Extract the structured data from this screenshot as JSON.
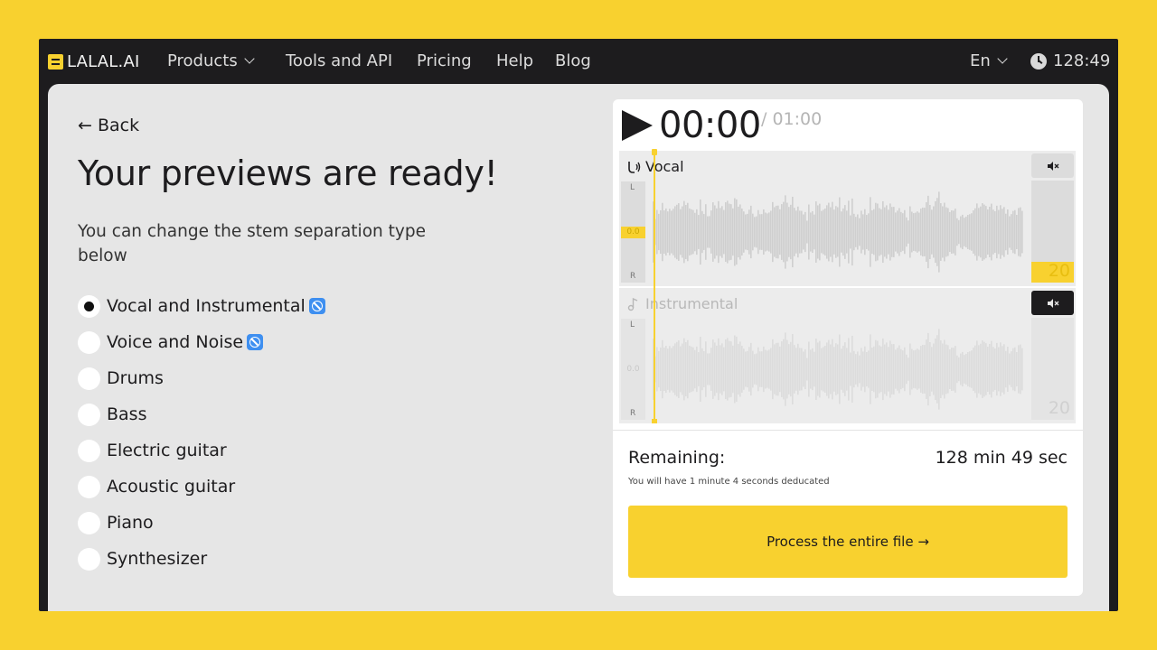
{
  "nav": {
    "logo": "LALAL.AI",
    "links": [
      {
        "label": "Products",
        "dropdown": true
      },
      {
        "label": "Tools and API"
      },
      {
        "label": "Pricing"
      },
      {
        "label": "Help"
      },
      {
        "label": "Blog"
      }
    ],
    "language": "En",
    "time_balance": "128:49"
  },
  "main": {
    "back": "← Back",
    "title": "Your previews are ready!",
    "subtitle": "You can change the stem separation type below",
    "options": [
      {
        "label": "Vocal and Instrumental",
        "checked": true,
        "badge": true
      },
      {
        "label": "Voice and Noise",
        "checked": false,
        "badge": true
      },
      {
        "label": "Drums",
        "checked": false
      },
      {
        "label": "Bass",
        "checked": false
      },
      {
        "label": "Electric guitar",
        "checked": false
      },
      {
        "label": "Acoustic guitar",
        "checked": false
      },
      {
        "label": "Piano",
        "checked": false
      },
      {
        "label": "Synthesizer",
        "checked": false
      }
    ]
  },
  "player": {
    "current_time": "00:00",
    "total_time": "/ 01:00",
    "tracks": [
      {
        "name": "Vocal",
        "meter_L": "L",
        "meter_R": "R",
        "meter_value": "0.0",
        "volume": "20",
        "muted": false,
        "active": true
      },
      {
        "name": "Instrumental",
        "meter_L": "L",
        "meter_R": "R",
        "meter_value": "0.0",
        "volume": "20",
        "muted": true,
        "active": false
      }
    ],
    "remaining_label": "Remaining:",
    "remaining_value": "128 min 49 sec",
    "remaining_note": "You will have 1 minute 4 seconds deducated",
    "process_button": "Process the entire file →"
  },
  "colors": {
    "accent": "#f8d12f",
    "dark": "#1d1c1e",
    "badge": "#3e8ff0"
  }
}
